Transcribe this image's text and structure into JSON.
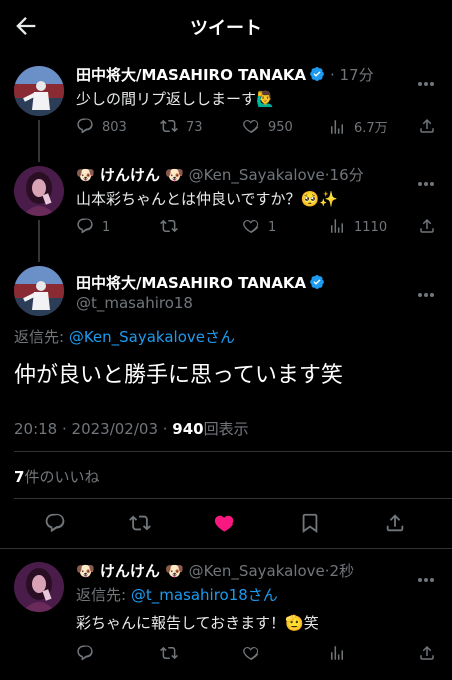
{
  "header": {
    "title": "ツイート"
  },
  "tweet1": {
    "name": "田中将大/MASAHIRO TANAKA",
    "sep": "·",
    "time": "17分",
    "text": "少しの間リプ返ししまーす",
    "emoji": "🙋‍♂️",
    "replies": "803",
    "retweets": "73",
    "likes": "950",
    "views": "6.7万"
  },
  "tweet2": {
    "name": "🐶 けんけん 🐶",
    "handle": "@Ken_Sayakalove",
    "sep": "·",
    "time": "16分",
    "text": "山本彩ちゃんとは仲良いですか？",
    "emoji": "🥺✨",
    "replies": "1",
    "likes": "1",
    "views": "1110"
  },
  "main": {
    "name": "田中将大/MASAHIRO TANAKA",
    "handle": "@t_masahiro18",
    "reply_prefix": "返信先: ",
    "reply_to": "@Ken_Sayakalove",
    "reply_suffix": "さん",
    "text": "仲が良いと勝手に思っています笑",
    "time": "20:18 · 2023/02/03 · ",
    "views_count": "940",
    "views_label": "回表示",
    "likes_count": "7",
    "likes_label": "件のいいね"
  },
  "reply": {
    "name": "🐶 けんけん 🐶",
    "handle": "@Ken_Sayakalove",
    "sep": "·",
    "time": "2秒",
    "reply_prefix": "返信先: ",
    "reply_to": "@t_masahiro18",
    "reply_suffix": "さん",
    "text": "彩ちゃんに報告しておきます！",
    "emoji": "🫡",
    "text_suffix": "笑"
  },
  "colors": {
    "accent": "#1d9bf0",
    "like_active": "#f91880",
    "muted": "#71767b",
    "background": "#000000"
  }
}
